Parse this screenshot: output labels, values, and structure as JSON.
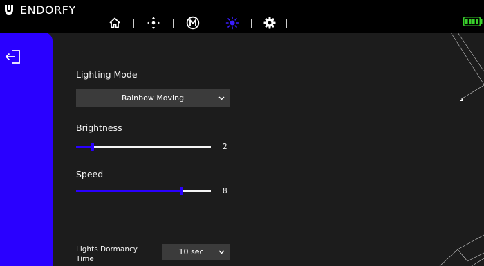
{
  "app": {
    "brand": "ENDORFY"
  },
  "nav": {
    "items": [
      {
        "name": "home"
      },
      {
        "name": "dpad"
      },
      {
        "name": "macro",
        "glyph": "M"
      },
      {
        "name": "lighting",
        "active": true
      },
      {
        "name": "settings"
      }
    ]
  },
  "battery": {
    "level": 1.0,
    "color": "#39d12b"
  },
  "colors": {
    "accent": "#2a00ff",
    "background": "#1c1c1c",
    "topbar": "#000000",
    "control": "#3b3b3b"
  },
  "lighting": {
    "mode_label": "Lighting Mode",
    "mode_value": "Rainbow Moving",
    "brightness_label": "Brightness",
    "brightness_value": "2",
    "brightness_fraction": 0.12,
    "speed_label": "Speed",
    "speed_value": "8",
    "speed_fraction": 0.78,
    "dormancy_label_line1": "Lights Dormancy",
    "dormancy_label_line2": "Time",
    "dormancy_value": "10 sec"
  }
}
